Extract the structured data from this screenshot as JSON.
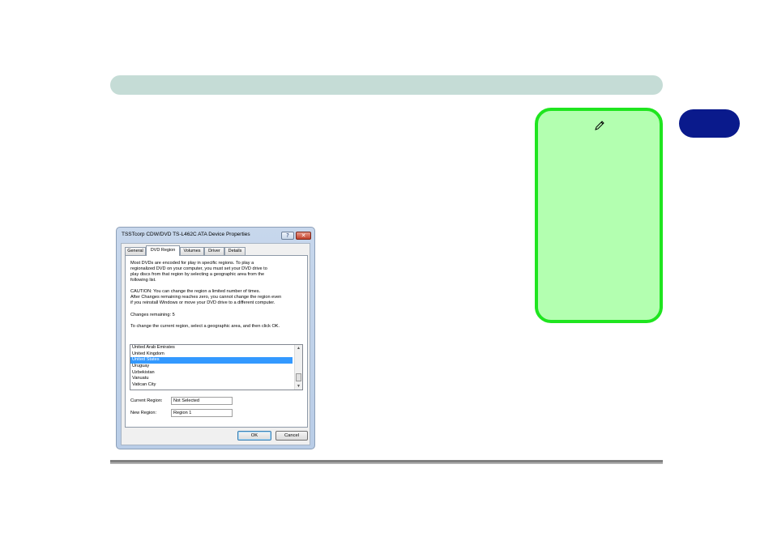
{
  "dialog": {
    "title": "TSSTcorp CDW/DVD TS-L462C ATA Device Properties",
    "help_glyph": "?",
    "close_glyph": "✕",
    "tabs": [
      {
        "label": "General",
        "active": false
      },
      {
        "label": "DVD Region",
        "active": true
      },
      {
        "label": "Volumes",
        "active": false
      },
      {
        "label": "Driver",
        "active": false
      },
      {
        "label": "Details",
        "active": false
      }
    ],
    "intro_lines": [
      "Most DVDs are encoded for play in specific regions. To play a",
      "regionalized DVD on your computer, you must set your DVD drive to",
      "play discs from that region by selecting a geographic area from the",
      "following list."
    ],
    "caution_lines": [
      "CAUTION:  You can change the region a limited number of times.",
      "After Changes remaining reaches zero, you cannot change the region even",
      "if you reinstall Windows or move your DVD drive to a different computer."
    ],
    "changes_remaining": "Changes remaining: 5",
    "instruction": "To change the current region, select a geographic area, and then click OK.",
    "region_list": [
      "United Arab Emirates",
      "United Kingdom",
      "United States",
      "Uruguay",
      "Uzbekistan",
      "Vanuatu",
      "Vatican City"
    ],
    "selected_region": "United States",
    "current_region_label": "Current Region:",
    "current_region_value": "Not Selected",
    "new_region_label": "New Region:",
    "new_region_value": "Region 1",
    "ok_label": "OK",
    "cancel_label": "Cancel"
  },
  "colors": {
    "header_bar": "#c5dcd6",
    "chapter_tab": "#0a1a8c",
    "note_fill": "#b3ffb0",
    "note_border": "#1fe51f",
    "list_selection": "#3399ff"
  },
  "note": {
    "icon": "pencil-icon"
  }
}
